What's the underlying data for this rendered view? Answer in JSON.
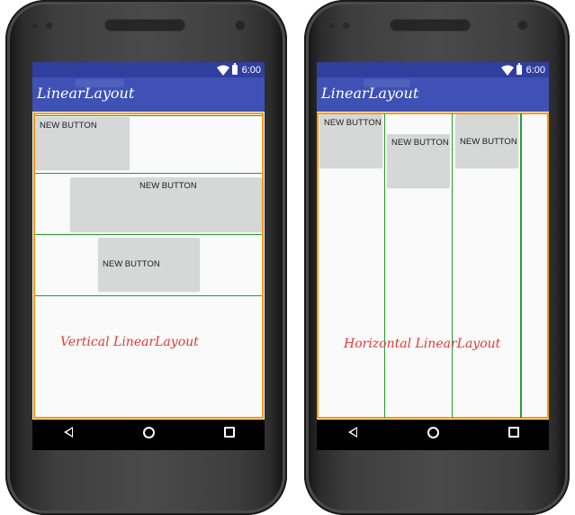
{
  "left_device": {
    "status_bar": {
      "time": "6:00"
    },
    "app_bar": {
      "title": "LinearLayout"
    },
    "buttons": [
      {
        "label": "NEW BUTTON"
      },
      {
        "label": "NEW BUTTON"
      },
      {
        "label": "NEW BUTTON"
      }
    ],
    "caption": "Vertical LinearLayout"
  },
  "right_device": {
    "status_bar": {
      "time": "6:00"
    },
    "app_bar": {
      "title": "LinearLayout"
    },
    "buttons": [
      {
        "label": "NEW BUTTON"
      },
      {
        "label": "NEW BUTTON"
      },
      {
        "label": "NEW BUTTON"
      }
    ],
    "caption": "Horizontal LinearLayout"
  },
  "colors": {
    "status_bar": "#303f9f",
    "app_bar": "#3f51b5",
    "layout_border": "#ff9800",
    "divider": "#239f2f",
    "caption": "#e53935",
    "button_bg": "#d6d7d7"
  },
  "icons": {
    "status": [
      "wifi-icon",
      "battery-icon"
    ],
    "navigation": [
      "back-icon",
      "home-icon",
      "recent-apps-icon"
    ]
  }
}
